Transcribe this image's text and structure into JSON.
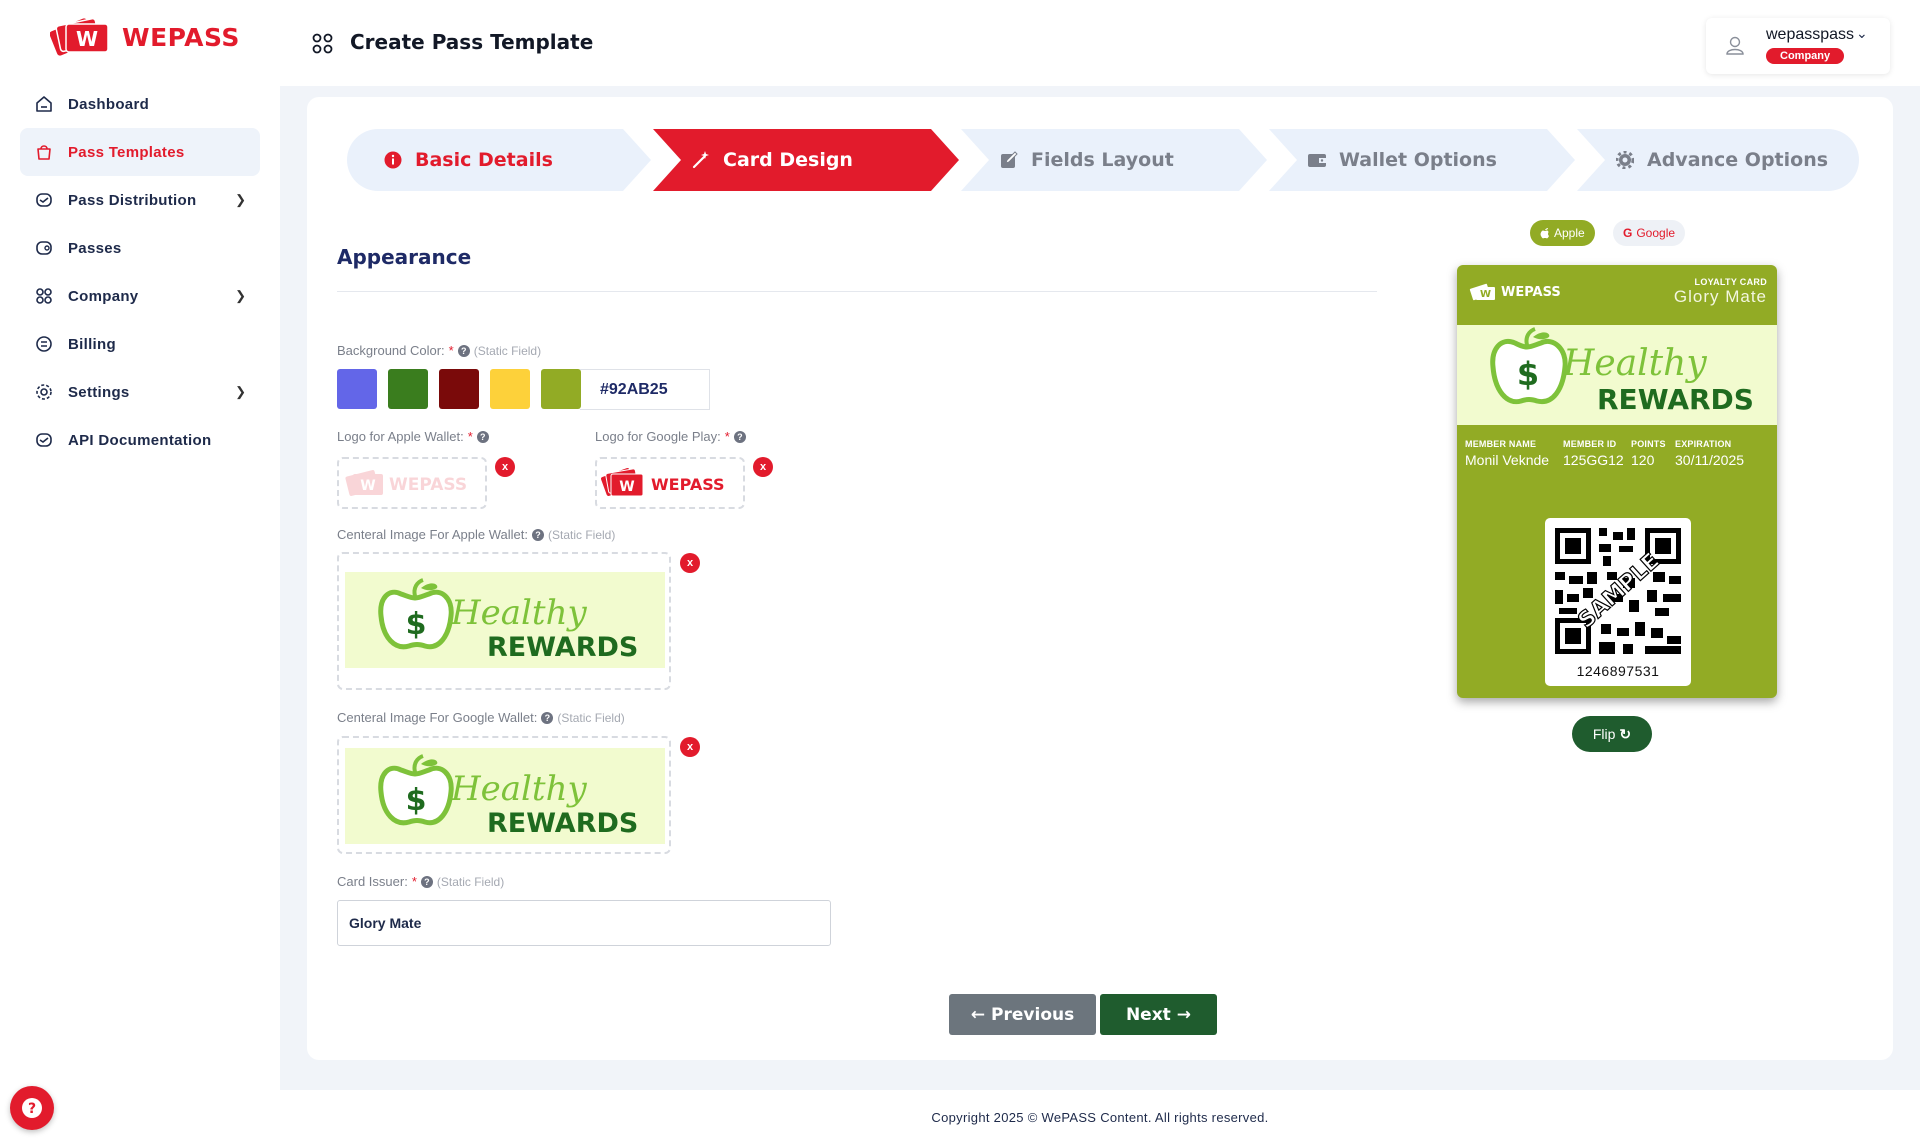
{
  "brand": {
    "name": "WEPASS",
    "accent": "#e21b2c"
  },
  "sidebar": {
    "items": [
      {
        "label": "Dashboard",
        "icon": "home-icon",
        "active": false,
        "has_children": false
      },
      {
        "label": "Pass Templates",
        "icon": "pass-icon",
        "active": true,
        "has_children": false
      },
      {
        "label": "Pass Distribution",
        "icon": "distribution-icon",
        "active": false,
        "has_children": true
      },
      {
        "label": "Passes",
        "icon": "passes-icon",
        "active": false,
        "has_children": false
      },
      {
        "label": "Company",
        "icon": "grid-icon",
        "active": false,
        "has_children": true
      },
      {
        "label": "Billing",
        "icon": "billing-icon",
        "active": false,
        "has_children": false
      },
      {
        "label": "Settings",
        "icon": "gear-icon",
        "active": false,
        "has_children": true
      },
      {
        "label": "API Documentation",
        "icon": "api-icon",
        "active": false,
        "has_children": false
      }
    ]
  },
  "header": {
    "title": "Create Pass Template",
    "user": {
      "name": "wepasspass",
      "role": "Company"
    }
  },
  "stepper": {
    "steps": [
      {
        "label": "Basic Details",
        "icon": "info-icon",
        "state": "completed"
      },
      {
        "label": "Card Design",
        "icon": "magic-wand-icon",
        "state": "active"
      },
      {
        "label": "Fields Layout",
        "icon": "edit-icon",
        "state": "pending"
      },
      {
        "label": "Wallet Options",
        "icon": "wallet-icon",
        "state": "pending"
      },
      {
        "label": "Advance Options",
        "icon": "gear-icon",
        "state": "pending"
      }
    ]
  },
  "form": {
    "section_title": "Appearance",
    "background_color": {
      "label": "Background Color:",
      "required": "*",
      "static_note": "(Static Field)",
      "swatches": [
        "#6366e8",
        "#3a7d1e",
        "#7a0a0a",
        "#fdd13a",
        "#92ab25"
      ],
      "value": "#92AB25"
    },
    "apple_logo": {
      "label": "Logo for Apple Wallet:",
      "required": "*"
    },
    "google_logo": {
      "label": "Logo for Google Play:",
      "required": "*"
    },
    "apple_image": {
      "label": "Centeral Image For Apple Wallet:",
      "static_note": "(Static Field)"
    },
    "google_image": {
      "label": "Centeral Image For Google Wallet:",
      "static_note": "(Static Field)"
    },
    "card_issuer": {
      "label": "Card Issuer:",
      "required": "*",
      "static_note": "(Static Field)",
      "value": "Glory Mate"
    },
    "remove_label": "x",
    "logo_text": "WEPASS",
    "healthy_script": "Healthy",
    "healthy_rewards": "REWARDS",
    "dollar": "$"
  },
  "buttons": {
    "previous": "Previous",
    "next": "Next",
    "flip": "Flip"
  },
  "preview": {
    "apple_label": "Apple",
    "google_label": "Google",
    "selected": "Apple",
    "pass_type": "LOYALTY CARD",
    "issuer": "Glory Mate",
    "logo_text": "WEPASS",
    "fields": [
      {
        "label": "MEMBER NAME",
        "value": "Monil Veknde"
      },
      {
        "label": "MEMBER ID",
        "value": "125GG12"
      },
      {
        "label": "POINTS",
        "value": "120"
      },
      {
        "label": "EXPIRATION",
        "value": "30/11/2025"
      }
    ],
    "barcode_number": "1246897531",
    "sample_text": "SAMPLE",
    "card_color": "#92ab25"
  },
  "footer": {
    "text": "Copyright 2025 © WePASS Content. All rights reserved."
  }
}
